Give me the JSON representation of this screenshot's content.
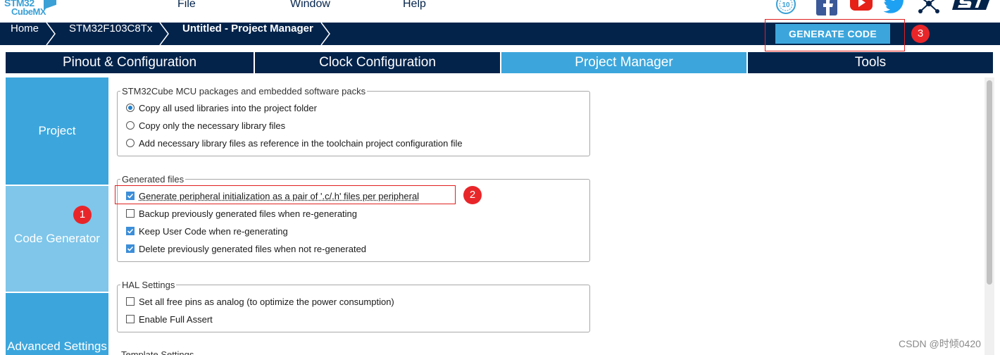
{
  "logo": {
    "line1": "STM32",
    "line2": "CubeMX"
  },
  "menu": {
    "file": "File",
    "window": "Window",
    "help": "Help"
  },
  "social_icons": [
    "anniversary-10-icon",
    "facebook-icon",
    "youtube-icon",
    "twitter-icon",
    "network-share-icon",
    "st-logo-icon"
  ],
  "breadcrumb": {
    "home": "Home",
    "mcu": "STM32F103C8Tx",
    "current": "Untitled - Project Manager"
  },
  "generate_button": "GENERATE CODE",
  "tabs": [
    "Pinout & Configuration",
    "Clock Configuration",
    "Project Manager",
    "Tools"
  ],
  "active_tab": "Project Manager",
  "sidebar": [
    "Project",
    "Code Generator",
    "Advanced Settings"
  ],
  "active_sidebar": "Code Generator",
  "groups": {
    "packages": {
      "legend": "STM32Cube MCU packages and embedded software packs",
      "options": [
        {
          "label": "Copy all used libraries into the project folder",
          "checked": true
        },
        {
          "label": "Copy only the necessary library files",
          "checked": false
        },
        {
          "label": "Add necessary library files as reference in the toolchain project configuration file",
          "checked": false
        }
      ]
    },
    "generated": {
      "legend": "Generated files",
      "options": [
        {
          "label": "Generate peripheral initialization as a pair of '.c/.h' files per peripheral",
          "checked": true
        },
        {
          "label": "Backup previously generated files when re-generating",
          "checked": false
        },
        {
          "label": "Keep User Code when re-generating",
          "checked": true
        },
        {
          "label": "Delete previously generated files when not re-generated",
          "checked": true
        }
      ]
    },
    "hal": {
      "legend": "HAL Settings",
      "options": [
        {
          "label": "Set all free pins as analog (to optimize the power consumption)",
          "checked": false
        },
        {
          "label": "Enable Full Assert",
          "checked": false
        }
      ]
    },
    "template": {
      "legend": "Template Settings"
    }
  },
  "annotations": [
    "1",
    "2",
    "3"
  ],
  "annotation_color": "#e8262a",
  "accent_color": "#3ca6dc",
  "navy_color": "#03234b",
  "watermark": "CSDN @时倾0420"
}
